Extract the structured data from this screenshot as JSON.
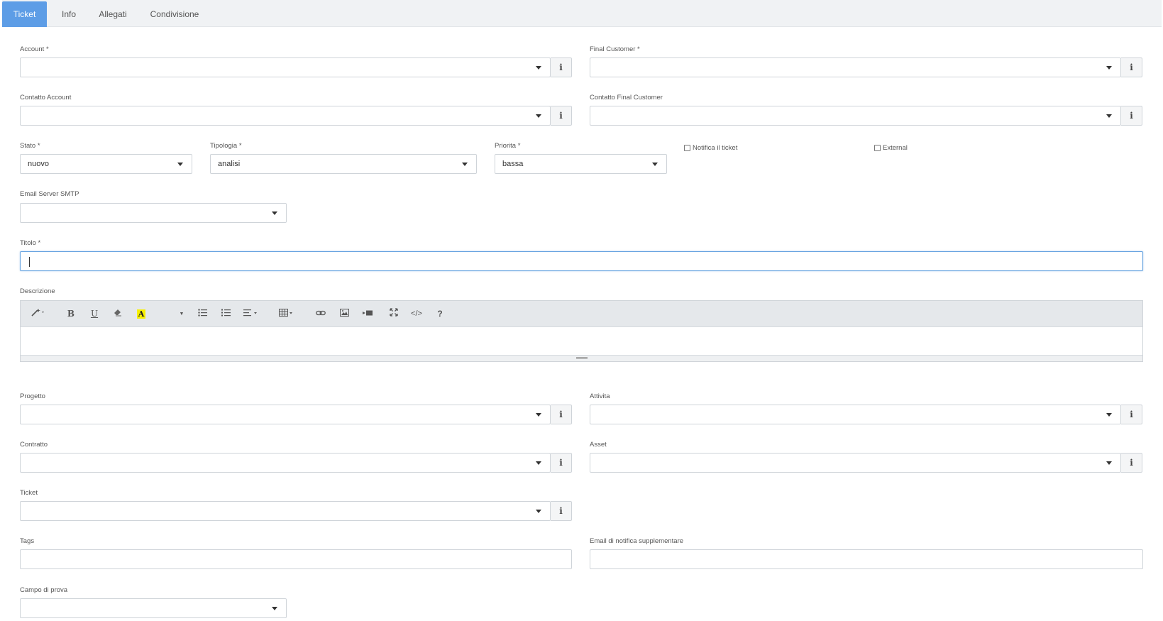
{
  "tabs": [
    {
      "label": "Ticket",
      "active": true
    },
    {
      "label": "Info",
      "active": false
    },
    {
      "label": "Allegati",
      "active": false
    },
    {
      "label": "Condivisione",
      "active": false
    }
  ],
  "form": {
    "account": {
      "label": "Account *",
      "value": ""
    },
    "final_customer": {
      "label": "Final Customer *",
      "value": ""
    },
    "contatto_account": {
      "label": "Contatto Account",
      "value": ""
    },
    "contatto_final_customer": {
      "label": "Contatto Final Customer",
      "value": ""
    },
    "stato": {
      "label": "Stato *",
      "value": "nuovo"
    },
    "tipologia": {
      "label": "Tipologia *",
      "value": "analisi"
    },
    "priorita": {
      "label": "Priorita *",
      "value": "bassa"
    },
    "notifica": {
      "label": "Notifica il ticket",
      "checked": false
    },
    "external": {
      "label": "External",
      "checked": false
    },
    "email_server": {
      "label": "Email Server SMTP",
      "value": ""
    },
    "titolo": {
      "label": "Titolo *",
      "value": ""
    },
    "descrizione": {
      "label": "Descrizione",
      "value": ""
    },
    "progetto": {
      "label": "Progetto",
      "value": ""
    },
    "attivita": {
      "label": "Attivita",
      "value": ""
    },
    "contratto": {
      "label": "Contratto",
      "value": ""
    },
    "asset": {
      "label": "Asset",
      "value": ""
    },
    "ticket": {
      "label": "Ticket",
      "value": ""
    },
    "tags": {
      "label": "Tags",
      "value": ""
    },
    "email_notifica": {
      "label": "Email di notifica supplementare",
      "value": ""
    },
    "campo_prova": {
      "label": "Campo di prova",
      "value": ""
    }
  },
  "icons": {
    "info": "i",
    "bold": "B",
    "underline": "U",
    "highlight": "A",
    "help": "?",
    "code": "</>"
  },
  "colors": {
    "accent": "#5d9de6",
    "highlight": "#f7f000"
  }
}
